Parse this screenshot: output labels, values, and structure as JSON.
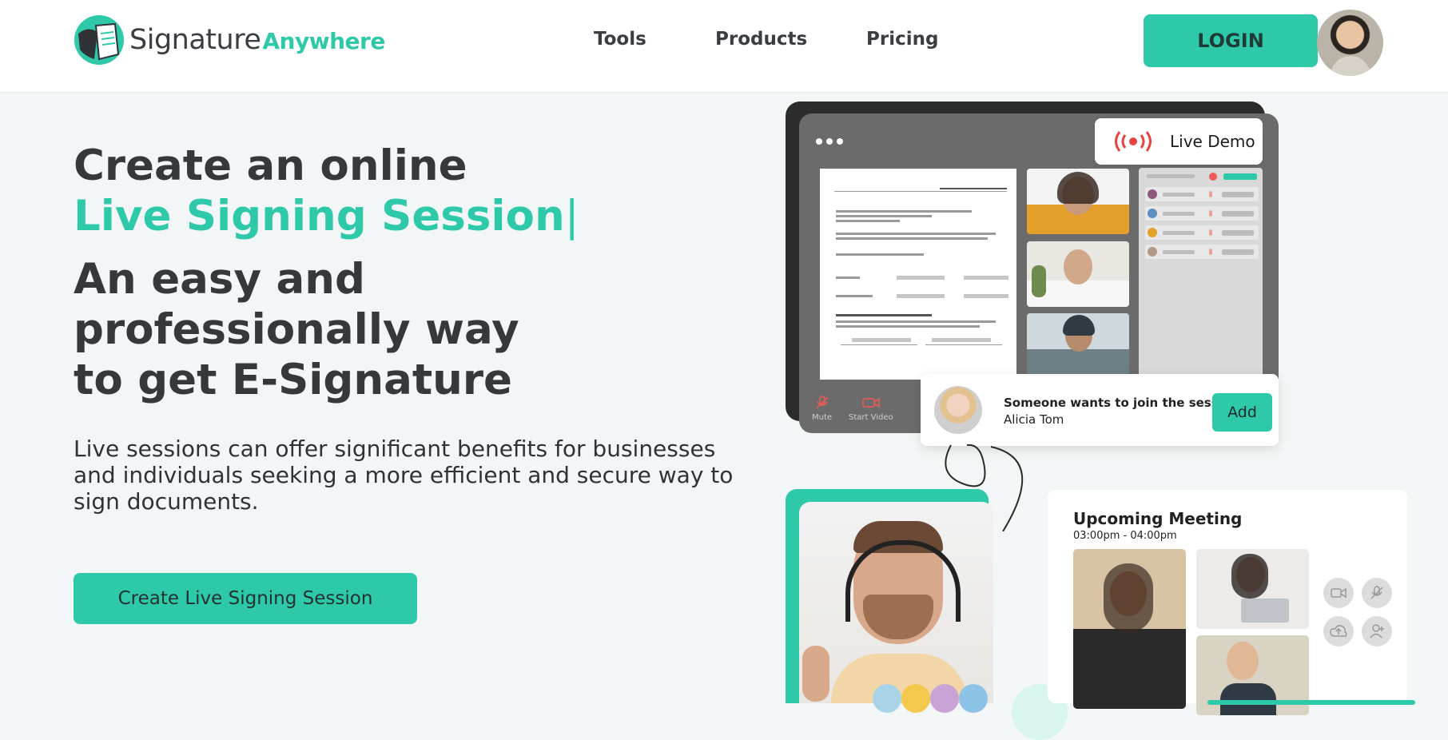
{
  "brand": {
    "name_main": "Signature",
    "name_accent": "Anywhere",
    "accent_color": "#2ec9a9"
  },
  "nav": {
    "items": [
      {
        "label": "Tools"
      },
      {
        "label": "Products"
      },
      {
        "label": "Pricing"
      }
    ],
    "login_label": "LOGIN"
  },
  "hero": {
    "line1": "Create an online",
    "highlight": "Live Signing Session",
    "caret": "|",
    "subtitle": "An easy and professionally way to get E-Signature",
    "description": "Live sessions can offer significant benefits for businesses and individuals seeking a more efficient and secure way to sign documents.",
    "cta_label": "Create Live Signing Session"
  },
  "demo": {
    "live_demo_label": "Live Demo",
    "toolbar": {
      "mute_label": "Mute",
      "video_label": "Start Video"
    },
    "join_request": {
      "message": "Someone wants to join the session",
      "name": "Alicia Tom",
      "add_label": "Add"
    },
    "meeting": {
      "title": "Upcoming Meeting",
      "time": "03:00pm - 04:00pm"
    }
  }
}
